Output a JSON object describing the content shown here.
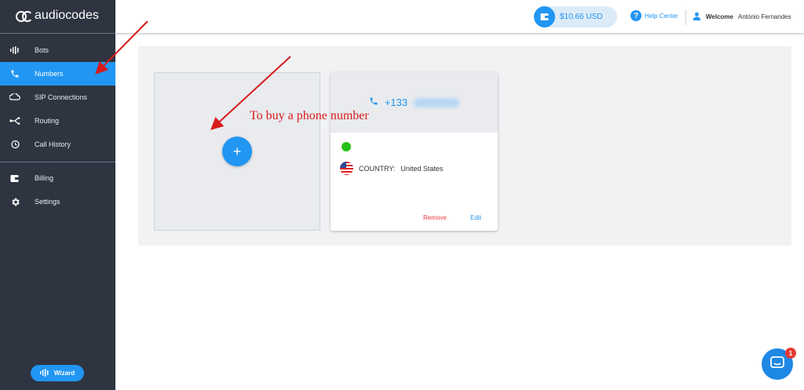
{
  "brand": {
    "name": "audiocodes"
  },
  "sidebar": {
    "items": [
      {
        "label": "Bots",
        "icon": "bots-icon"
      },
      {
        "label": "Numbers",
        "icon": "phone-icon",
        "active": true
      },
      {
        "label": "SIP Connections",
        "icon": "sip-connections-icon"
      },
      {
        "label": "Routing",
        "icon": "routing-icon"
      },
      {
        "label": "Call History",
        "icon": "call-history-icon"
      }
    ],
    "items2": [
      {
        "label": "Billing",
        "icon": "wallet-icon"
      },
      {
        "label": "Settings",
        "icon": "gear-icon"
      }
    ],
    "wizard_label": "Wizard"
  },
  "header": {
    "balance": "$10.66 USD",
    "help_label": "Help Center",
    "welcome_prefix": "Welcome",
    "user_name": "António Fernandes"
  },
  "numbers": {
    "add_symbol": "+",
    "cards": [
      {
        "number_prefix": "+133",
        "country_label": "COUNTRY:",
        "country": "United States",
        "status_color": "#25c116",
        "remove_label": "Remove",
        "edit_label": "Edit"
      }
    ]
  },
  "annotation": {
    "text": "To buy a phone number",
    "color": "#d81b1b"
  },
  "chat": {
    "badge_count": "1"
  },
  "colors": {
    "accent": "#2196f3",
    "sidebar_bg": "#2f3441",
    "danger": "#e53935"
  }
}
